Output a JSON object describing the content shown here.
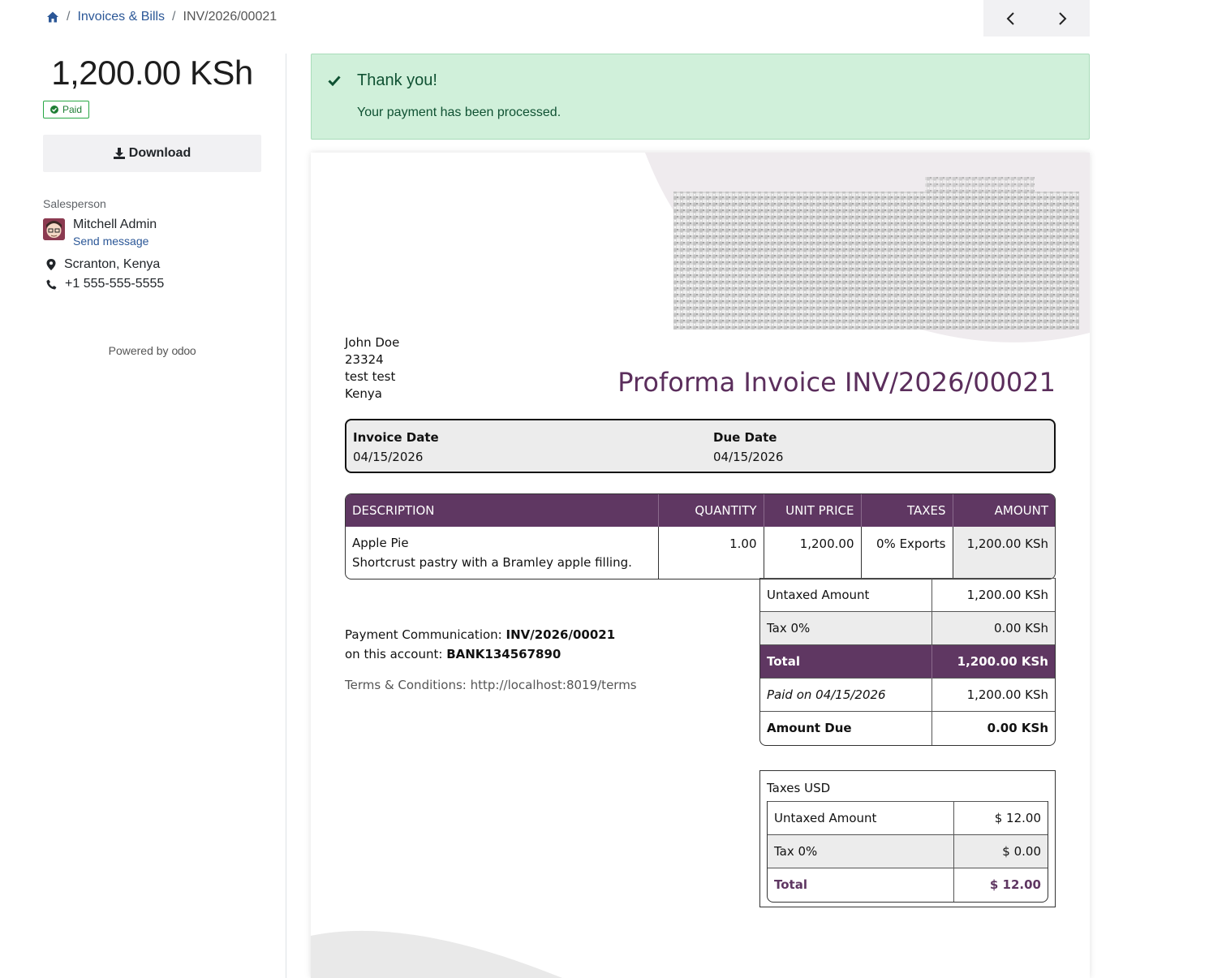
{
  "breadcrumb": {
    "home_icon": "home-icon",
    "items": [
      "Invoices & Bills",
      "INV/2026/00021"
    ]
  },
  "pager": {
    "prev_icon": "chevron-left-icon",
    "next_icon": "chevron-right-icon"
  },
  "sidebar": {
    "amount": "1,200.00 KSh",
    "status": "Paid",
    "download_label": "Download",
    "salesperson_label": "Salesperson",
    "salesperson_name": "Mitchell Admin",
    "send_message": "Send message",
    "location": "Scranton, Kenya",
    "phone": "+1 555-555-5555",
    "powered_by": "Powered by",
    "powered_brand": "odoo"
  },
  "alert": {
    "title": "Thank you!",
    "message": "Your payment has been processed."
  },
  "invoice": {
    "customer": [
      "John Doe",
      "23324",
      "test test",
      "Kenya"
    ],
    "title": "Proforma Invoice INV/2026/00021",
    "invoice_date_label": "Invoice Date",
    "invoice_date": "04/15/2026",
    "due_date_label": "Due Date",
    "due_date": "04/15/2026",
    "columns": [
      "DESCRIPTION",
      "QUANTITY",
      "UNIT PRICE",
      "TAXES",
      "AMOUNT"
    ],
    "lines": [
      {
        "name": "Apple Pie",
        "description": "Shortcrust pastry with a Bramley apple filling.",
        "quantity": "1.00",
        "unit_price": "1,200.00",
        "taxes": "0% Exports",
        "amount": "1,200.00 KSh"
      }
    ],
    "totals": {
      "untaxed_label": "Untaxed Amount",
      "untaxed": "1,200.00 KSh",
      "tax_label": "Tax 0%",
      "tax": "0.00 KSh",
      "total_label": "Total",
      "total": "1,200.00 KSh",
      "paid_label": "Paid on 04/15/2026",
      "paid": "1,200.00 KSh",
      "due_label": "Amount Due",
      "due": "0.00 KSh"
    },
    "payment_comm_label": "Payment Communication:",
    "payment_comm": "INV/2026/00021",
    "account_label": "on this account:",
    "account": "BANK134567890",
    "terms": "Terms & Conditions: http://localhost:8019/terms",
    "taxes_usd": {
      "header": "Taxes USD",
      "untaxed_label": "Untaxed Amount",
      "untaxed": "$ 12.00",
      "tax_label": "Tax 0%",
      "tax": "$ 0.00",
      "total_label": "Total",
      "total": "$ 12.00"
    }
  },
  "colors": {
    "brand": "#5f3762",
    "link": "#2b5797",
    "success_bg": "#d0f0da",
    "success_text": "#0f5132"
  }
}
